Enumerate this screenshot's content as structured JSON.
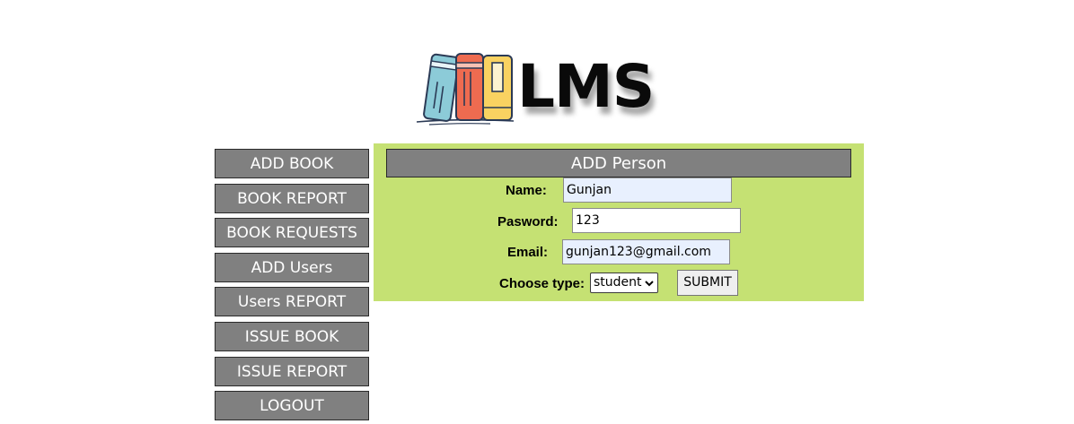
{
  "logo": {
    "text": "LMS",
    "icon": "books-icon",
    "colors": {
      "blue_book": "#8ccbd8",
      "red_book": "#ee6b50",
      "yellow_book": "#f9d261",
      "outline": "#2b3a55"
    }
  },
  "sidebar": {
    "items": [
      {
        "label": "ADD BOOK"
      },
      {
        "label": "BOOK REPORT"
      },
      {
        "label": "BOOK REQUESTS"
      },
      {
        "label": "ADD Users"
      },
      {
        "label": "Users REPORT"
      },
      {
        "label": "ISSUE BOOK"
      },
      {
        "label": "ISSUE REPORT"
      },
      {
        "label": "LOGOUT"
      }
    ]
  },
  "form": {
    "title": "ADD Person",
    "name_label": "Name:",
    "name_value": "Gunjan",
    "password_label": "Pasword:",
    "password_value": "123",
    "email_label": "Email:",
    "email_value": "gunjan123@gmail.com",
    "type_label": "Choose type:",
    "type_selected": "student",
    "submit_label": "SUBMIT"
  },
  "colors": {
    "panel_bg": "#c5e173",
    "button_bg": "#808080",
    "autofill_bg": "#e8f0fe"
  }
}
